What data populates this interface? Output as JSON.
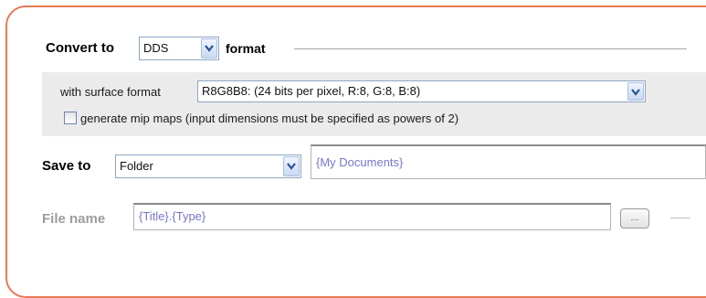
{
  "convert": {
    "label_prefix": "Convert to",
    "format_value": "DDS",
    "label_suffix": "format"
  },
  "surface": {
    "label": "with surface format",
    "value": "R8G8B8: (24 bits per pixel, R:8, G:8, B:8)"
  },
  "mipmaps": {
    "label": "generate mip maps (input dimensions must be specified as powers of 2)",
    "checked": false
  },
  "save": {
    "label": "Save to",
    "location_type": "Folder",
    "path": "{My Documents}"
  },
  "filename": {
    "label": "File name",
    "value": "{Title}.{Type}",
    "browse_label": "..."
  },
  "colors": {
    "frame_border": "#e87a55",
    "placeholder_text": "#7777cc",
    "disabled_text": "#9c9c9c"
  },
  "icons": {
    "dropdown": "chevron-down-icon"
  }
}
